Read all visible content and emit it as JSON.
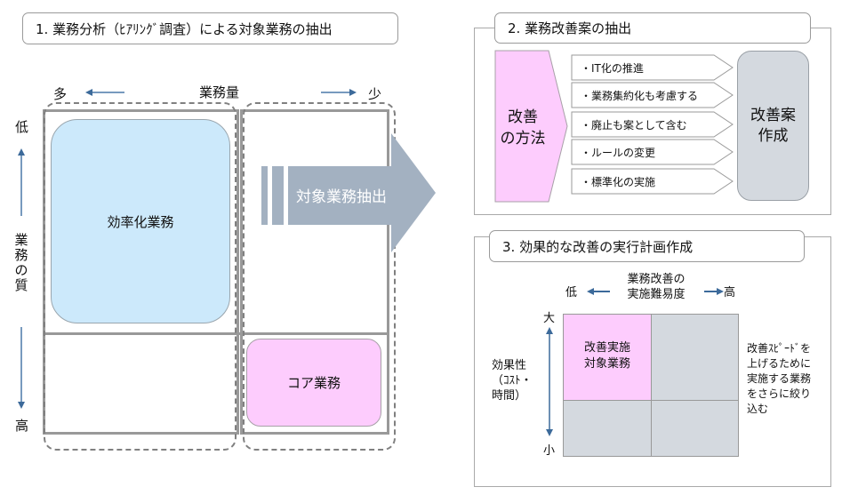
{
  "section1": {
    "title": "1. 業務分析（ﾋｱﾘﾝｸﾞ調査）による対象業務の抽出",
    "x_axis": {
      "label": "業務量",
      "left": "多",
      "right": "少"
    },
    "y_axis": {
      "label": "業務の質",
      "top": "低",
      "bottom": "高",
      "label_chars": [
        "業",
        "務",
        "の",
        "質"
      ]
    },
    "quadrants": {
      "efficiency": "効率化業務",
      "core": "コア業務"
    },
    "extraction_arrow": "対象業務抽出"
  },
  "section2": {
    "title": "2. 業務改善案の抽出",
    "method_label": [
      "改善",
      "の方法"
    ],
    "methods": [
      "・IT化の推進",
      "・業務集約化も考慮する",
      "・廃止も案として含む",
      "・ルールの変更",
      "・標準化の実施"
    ],
    "result_label": [
      "改善案",
      "作成"
    ]
  },
  "section3": {
    "title": "3. 効果的な改善の実行計画作成",
    "x_axis": {
      "label": [
        "業務改善の",
        "実施難易度"
      ],
      "left": "低",
      "right": "高"
    },
    "y_axis": {
      "label": [
        "効果性",
        "（ｺｽﾄ・",
        "時間）"
      ],
      "top": "大",
      "bottom": "小"
    },
    "target_cell": [
      "改善実施",
      "対象業務"
    ],
    "note": [
      "改善ｽﾋﾟｰﾄﾞを",
      "上げるために",
      "実施する業務",
      "をさらに絞り",
      "込む"
    ]
  },
  "colors": {
    "efficiency_fill": "#cce9fb",
    "core_fill": "#fdccfd",
    "arrow_fill": "#a3b1c1",
    "grey_cell": "#d4d9df",
    "axis_arrow": "#3c6a9a",
    "grid_line": "#999999"
  }
}
